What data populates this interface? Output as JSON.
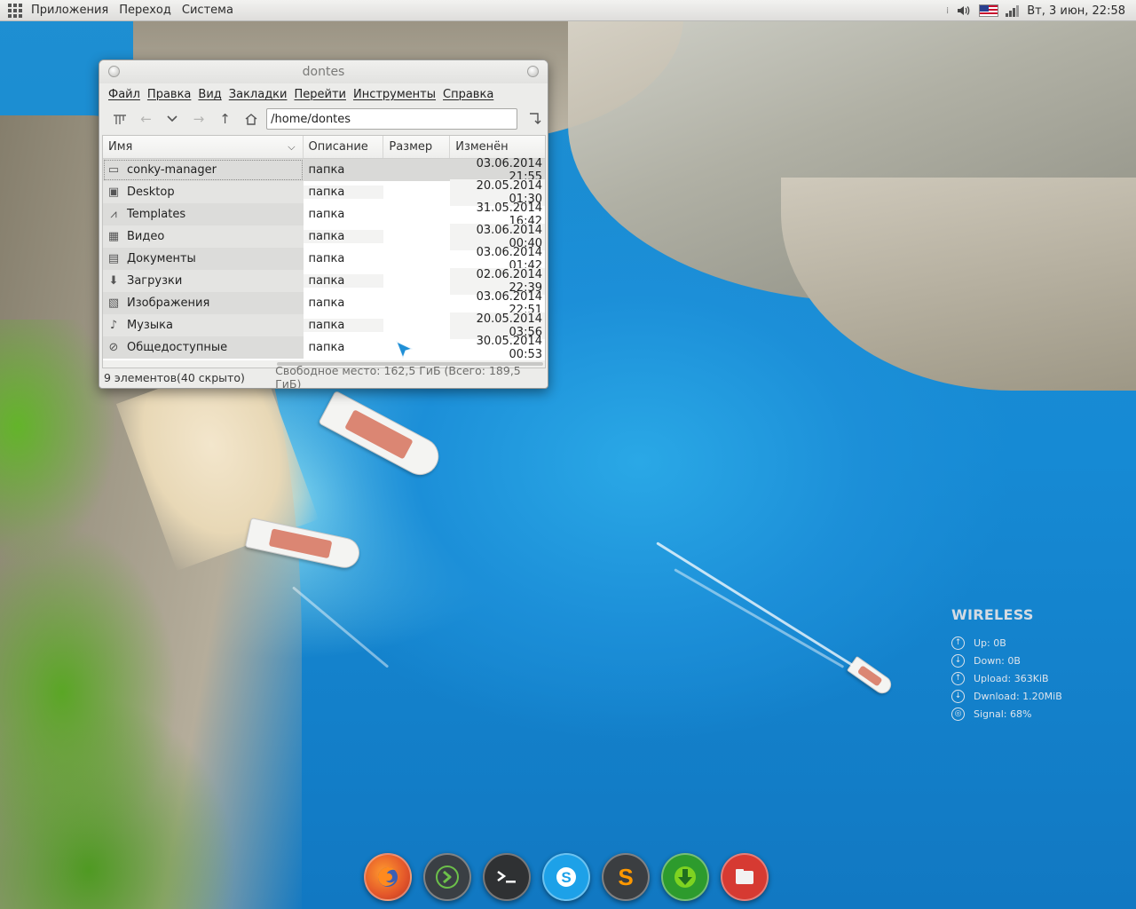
{
  "top_panel": {
    "menus": [
      "Приложения",
      "Переход",
      "Система"
    ],
    "clock": "Вт,  3 июн, 22:58"
  },
  "file_manager": {
    "title": "dontes",
    "menus": [
      "Файл",
      "Правка",
      "Вид",
      "Закладки",
      "Перейти",
      "Инструменты",
      "Справка"
    ],
    "path": "/home/dontes",
    "columns": [
      "Имя",
      "Описание",
      "Размер",
      "Изменён"
    ],
    "rows": [
      {
        "name": "conky-manager",
        "desc": "папка",
        "size": "",
        "modified": "03.06.2014 21:55",
        "icon": "folder-icon"
      },
      {
        "name": "Desktop",
        "desc": "папка",
        "size": "",
        "modified": "20.05.2014 01:30",
        "icon": "desktop-icon"
      },
      {
        "name": "Templates",
        "desc": "папка",
        "size": "",
        "modified": "31.05.2014 16:42",
        "icon": "templates-icon"
      },
      {
        "name": "Видео",
        "desc": "папка",
        "size": "",
        "modified": "03.06.2014 00:40",
        "icon": "video-icon"
      },
      {
        "name": "Документы",
        "desc": "папка",
        "size": "",
        "modified": "03.06.2014 01:42",
        "icon": "documents-icon"
      },
      {
        "name": "Загрузки",
        "desc": "папка",
        "size": "",
        "modified": "02.06.2014 22:39",
        "icon": "download-icon"
      },
      {
        "name": "Изображения",
        "desc": "папка",
        "size": "",
        "modified": "03.06.2014 22:51",
        "icon": "pictures-icon"
      },
      {
        "name": "Музыка",
        "desc": "папка",
        "size": "",
        "modified": "20.05.2014 03:56",
        "icon": "music-icon"
      },
      {
        "name": "Общедоступные",
        "desc": "папка",
        "size": "",
        "modified": "30.05.2014 00:53",
        "icon": "public-icon"
      }
    ],
    "status_left": "9 элементов(40 скрыто)",
    "status_right": "Свободное место: 162,5 ГиБ (Всего: 189,5 ГиБ)"
  },
  "conky": {
    "title": "WIRELESS",
    "rows": [
      {
        "label": "Up: 0B",
        "icon": "up-arrow-icon"
      },
      {
        "label": "Down: 0B",
        "icon": "down-arrow-icon"
      },
      {
        "label": "Upload: 363KiB",
        "icon": "up-arrow-icon"
      },
      {
        "label": "Dwnload: 1.20MiB",
        "icon": "down-arrow-icon"
      },
      {
        "label": "Signal: 68%",
        "icon": "signal-ring-icon"
      }
    ]
  },
  "dock": {
    "items": [
      "firefox-icon",
      "feedly-icon",
      "terminal-icon",
      "skype-icon",
      "sublime-text-icon",
      "download-manager-icon",
      "files-icon"
    ]
  },
  "colors": {
    "panel_bg": "#dedddb",
    "window_bg": "#ececea",
    "selected_row": "#d9d9d7",
    "sea": "#1c8fd8"
  }
}
